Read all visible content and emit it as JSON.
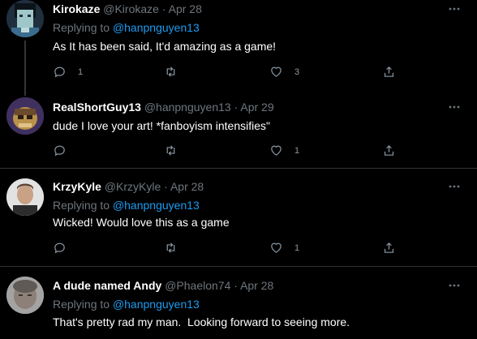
{
  "tweets": [
    {
      "name": "Kirokaze",
      "handle": "@Kirokaze",
      "dot": "·",
      "date": "Apr 28",
      "replying_prefix": "Replying to",
      "replying_to": "@hanpnguyen13",
      "text": "As It has been said, It'd amazing as a game!",
      "replies": "1",
      "retweets": "",
      "likes": "3"
    },
    {
      "name": "RealShortGuy13",
      "handle": "@hanpnguyen13",
      "dot": "·",
      "date": "Apr 29",
      "text": "dude I love your art! *fanboyism intensifies\"",
      "replies": "",
      "retweets": "",
      "likes": "1"
    },
    {
      "name": "KrzyKyle",
      "handle": "@KrzyKyle",
      "dot": "·",
      "date": "Apr 28",
      "replying_prefix": "Replying to",
      "replying_to": "@hanpnguyen13",
      "text": "Wicked! Would love this as a game",
      "replies": "",
      "retweets": "",
      "likes": "1"
    },
    {
      "name": "A dude named Andy",
      "handle": "@Phaelon74",
      "dot": "·",
      "date": "Apr 28",
      "replying_prefix": "Replying to",
      "replying_to": "@hanpnguyen13",
      "text": "That's pretty rad my man.  Looking forward to seeing more."
    }
  ],
  "colors": {
    "background": "#000000",
    "text": "#ffffff",
    "muted": "#6e767d",
    "link": "#1d9bf0",
    "divider": "#2f3336"
  }
}
